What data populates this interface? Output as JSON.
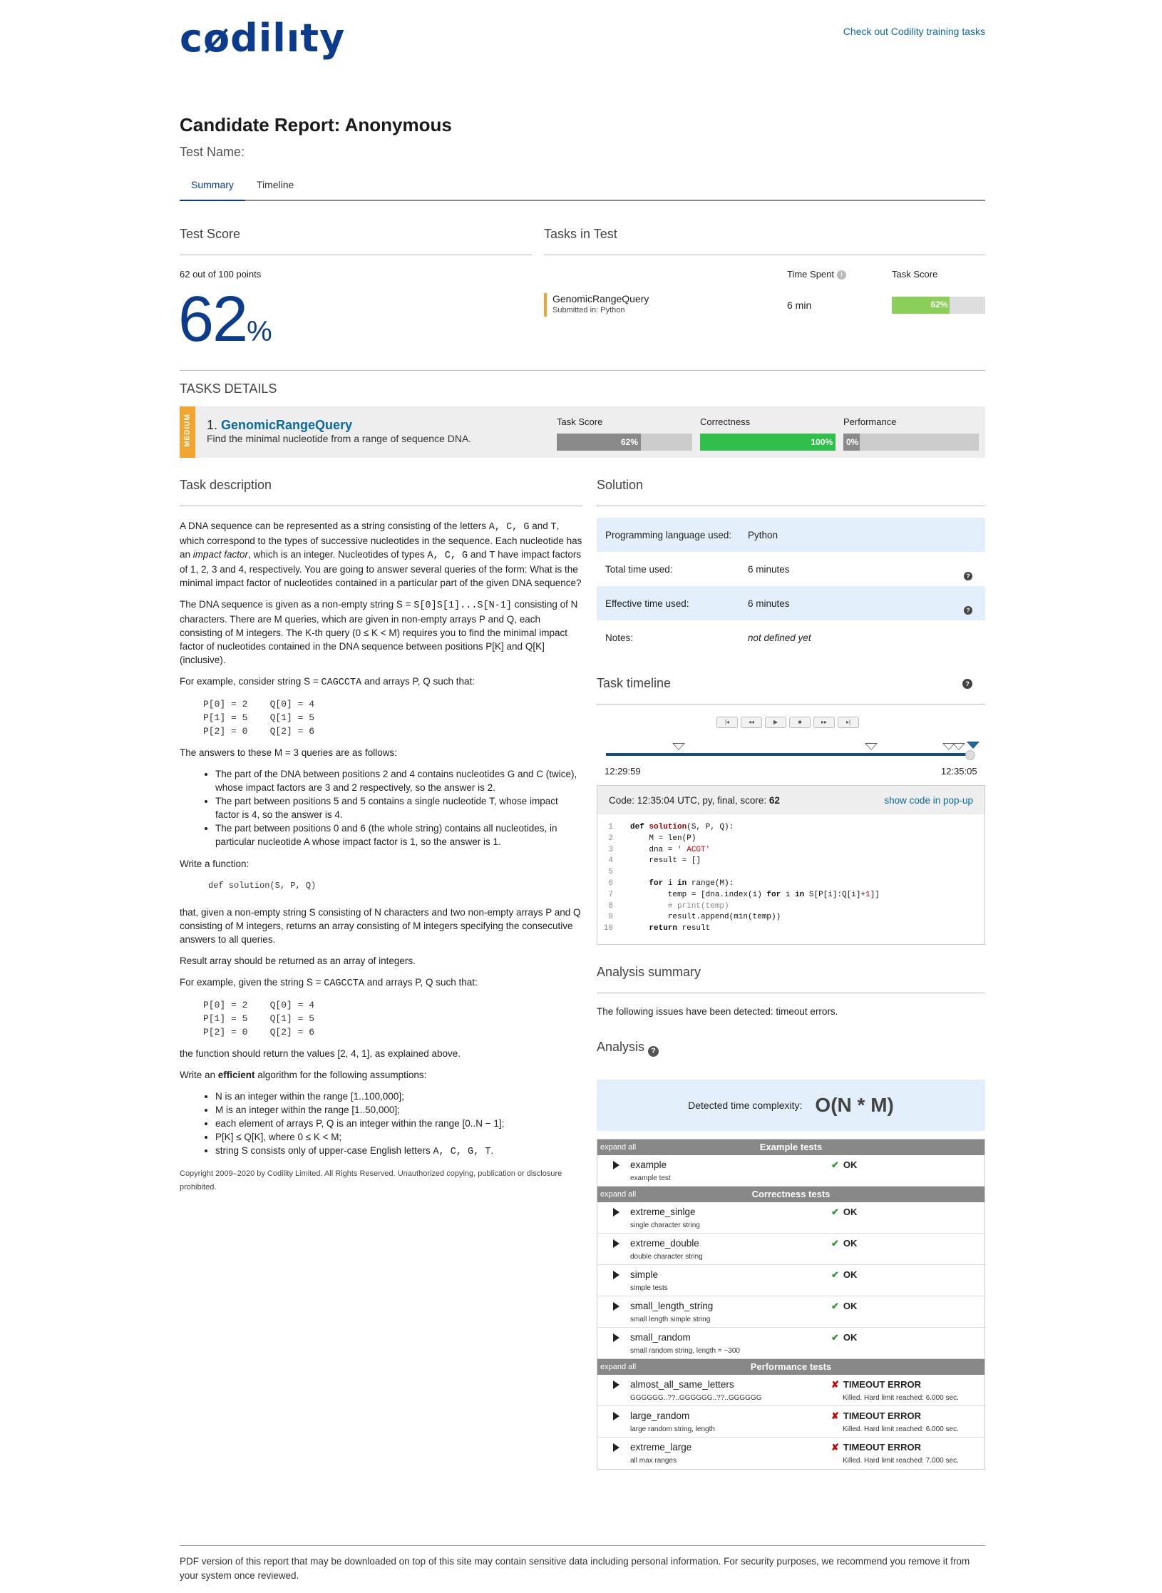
{
  "header": {
    "logo": "cødilıty",
    "training_link": "Check out Codility training tasks"
  },
  "report": {
    "title": "Candidate Report: Anonymous",
    "test_name": "Test Name:",
    "tabs": [
      "Summary",
      "Timeline"
    ]
  },
  "score": {
    "heading": "Test Score",
    "points": "62 out of 100 points",
    "percent": "62",
    "percent_sign": "%"
  },
  "tasks_in_test": {
    "heading": "Tasks in Test",
    "col_time": "Time Spent",
    "col_score": "Task Score",
    "task_name": "GenomicRangeQuery",
    "submitted": "Submitted in: Python",
    "time": "6 min",
    "score_label": "62%",
    "score_fraction": 0.62
  },
  "tasks_details": {
    "heading": "TASKS DETAILS",
    "difficulty": "MEDIUM",
    "number": "1.",
    "name": "GenomicRangeQuery",
    "description": "Find the minimal nucleotide from a range of sequence DNA.",
    "cols": [
      "Task Score",
      "Correctness",
      "Performance"
    ],
    "values": [
      "62%",
      "100%",
      "0%"
    ],
    "fractions": [
      0.62,
      1.0,
      0.0
    ]
  },
  "description": {
    "heading": "Task description",
    "p1a": "A DNA sequence can be represented as a string consisting of the letters ",
    "p1b": "A, C, G",
    "p1c": " and ",
    "p1d": "T",
    "p1e": ", which correspond to the types of successive nucleotides in the sequence. Each nucleotide has an ",
    "p1f": "impact factor",
    "p1g": ", which is an integer. Nucleotides of types ",
    "p1h": "A, C, G",
    "p1i": " and ",
    "p1j": "T",
    "p1k": " have impact factors of 1, 2, 3 and 4, respectively. You are going to answer several queries of the form: What is the minimal impact factor of nucleotides contained in a particular part of the given DNA sequence?",
    "p2a": "The DNA sequence is given as a non-empty string S = ",
    "p2b": "S[0]S[1]...S[N-1]",
    "p2c": " consisting of N characters. There are M queries, which are given in non-empty arrays P and Q, each consisting of M integers. The K-th query (0 ≤ K < M) requires you to find the minimal impact factor of nucleotides contained in the DNA sequence between positions P[K] and Q[K] (inclusive).",
    "p3a": "For example, consider string S = ",
    "p3b": "CAGCCTA",
    "p3c": " and arrays P, Q such that:",
    "ex_lines": [
      "P[0] = 2    Q[0] = 4",
      "P[1] = 5    Q[1] = 5",
      "P[2] = 0    Q[2] = 6"
    ],
    "p4": "The answers to these M = 3 queries are as follows:",
    "li1": "The part of the DNA between positions 2 and 4 contains nucleotides G and C (twice), whose impact factors are 3 and 2 respectively, so the answer is 2.",
    "li2": "The part between positions 5 and 5 contains a single nucleotide T, whose impact factor is 4, so the answer is 4.",
    "li3": "The part between positions 0 and 6 (the whole string) contains all nucleotides, in particular nucleotide A whose impact factor is 1, so the answer is 1.",
    "p5": "Write a function:",
    "fn_sig": "def solution(S, P, Q)",
    "p6": "that, given a non-empty string S consisting of N characters and two non-empty arrays P and Q consisting of M integers, returns an array consisting of M integers specifying the consecutive answers to all queries.",
    "p7": "Result array should be returned as an array of integers.",
    "p8a": "For example, given the string S = ",
    "p8b": "CAGCCTA",
    "p8c": " and arrays P, Q such that:",
    "p9": "the function should return the values [2, 4, 1], as explained above.",
    "p10a": "Write an ",
    "p10b": "efficient",
    "p10c": " algorithm for the following assumptions:",
    "assumptions": [
      "N is an integer within the range [1..100,000];",
      "M is an integer within the range [1..50,000];",
      "each element of arrays P, Q is an integer within the range [0..N − 1];",
      "P[K] ≤ Q[K], where 0 ≤ K < M;"
    ],
    "a5a": "string S consists only of upper-case English letters ",
    "a5b": "A, C, G, T",
    "a5c": ".",
    "copyright": "Copyright 2009–2020 by Codility Limited. All Rights Reserved. Unauthorized copying, publication or disclosure prohibited."
  },
  "solution": {
    "heading": "Solution",
    "rows": [
      {
        "k": "Programming language used:",
        "v": "Python"
      },
      {
        "k": "Total time used:",
        "v": "6 minutes"
      },
      {
        "k": "Effective time used:",
        "v": "6 minutes"
      },
      {
        "k": "Notes:",
        "v": "not defined yet"
      }
    ]
  },
  "timeline": {
    "heading": "Task timeline",
    "start": "12:29:59",
    "end": "12:35:05",
    "buttons": [
      "|◂",
      "◂◂",
      "▶",
      "■",
      "▸▸",
      "▸|"
    ]
  },
  "code": {
    "head_a": "Code: 12:35:04 UTC, py, final, score: ",
    "head_score": "62",
    "popup": "show code in pop-up"
  },
  "analysis_summary": {
    "heading": "Analysis summary",
    "text": "The following issues have been detected: timeout errors."
  },
  "analysis": {
    "heading": "Analysis",
    "complexity_label": "Detected time complexity:",
    "complexity": "O(N * M)",
    "expand_all": "expand all",
    "groups": [
      {
        "title": "Example tests",
        "tests": [
          {
            "name": "example",
            "sub": "example test",
            "result": "OK",
            "ok": true,
            "rsub": ""
          }
        ]
      },
      {
        "title": "Correctness tests",
        "tests": [
          {
            "name": "extreme_sinlge",
            "sub": "single character string",
            "result": "OK",
            "ok": true,
            "rsub": ""
          },
          {
            "name": "extreme_double",
            "sub": "double character string",
            "result": "OK",
            "ok": true,
            "rsub": ""
          },
          {
            "name": "simple",
            "sub": "simple tests",
            "result": "OK",
            "ok": true,
            "rsub": ""
          },
          {
            "name": "small_length_string",
            "sub": "small length simple string",
            "result": "OK",
            "ok": true,
            "rsub": ""
          },
          {
            "name": "small_random",
            "sub": "small random string, length = ~300",
            "result": "OK",
            "ok": true,
            "rsub": ""
          }
        ]
      },
      {
        "title": "Performance tests",
        "tests": [
          {
            "name": "almost_all_same_letters",
            "sub": "GGGGGG..??..GGGGGG..??..GGGGGG",
            "result": "TIMEOUT ERROR",
            "ok": false,
            "rsub": "Killed. Hard limit reached: 6.000 sec."
          },
          {
            "name": "large_random",
            "sub": "large random string, length",
            "result": "TIMEOUT ERROR",
            "ok": false,
            "rsub": "Killed. Hard limit reached: 6.000 sec."
          },
          {
            "name": "extreme_large",
            "sub": "all max ranges",
            "result": "TIMEOUT ERROR",
            "ok": false,
            "rsub": "Killed. Hard limit reached: 7.000 sec."
          }
        ]
      }
    ]
  },
  "footer": {
    "text": "PDF version of this report that may be downloaded on top of this site may contain sensitive data including personal information. For security purposes, we recommend you remove it from your system once reviewed."
  },
  "colors": {
    "brand": "#0b3b8c",
    "link": "#0a6aa1",
    "ok": "#2a9b2a",
    "error": "#cc0000",
    "medium": "#f0a630",
    "score_green": "#8ccf5a",
    "correctness_green": "#2fbf4a"
  }
}
